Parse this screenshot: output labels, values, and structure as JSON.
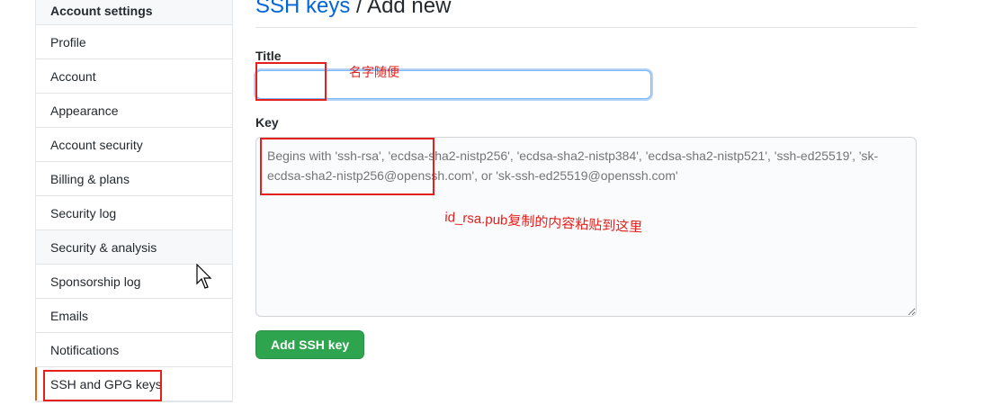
{
  "sidebar": {
    "header": "Account settings",
    "items": [
      {
        "label": "Profile"
      },
      {
        "label": "Account"
      },
      {
        "label": "Appearance"
      },
      {
        "label": "Account security"
      },
      {
        "label": "Billing & plans"
      },
      {
        "label": "Security log"
      },
      {
        "label": "Security & analysis"
      },
      {
        "label": "Sponsorship log"
      },
      {
        "label": "Emails"
      },
      {
        "label": "Notifications"
      },
      {
        "label": "SSH and GPG keys"
      }
    ]
  },
  "main": {
    "breadcrumb_link": "SSH keys",
    "breadcrumb_rest": " / Add new",
    "title_label": "Title",
    "title_value": "",
    "key_label": "Key",
    "key_placeholder": "Begins with 'ssh-rsa', 'ecdsa-sha2-nistp256', 'ecdsa-sha2-nistp384', 'ecdsa-sha2-nistp521', 'ssh-ed25519', 'sk-ecdsa-sha2-nistp256@openssh.com', or 'sk-ssh-ed25519@openssh.com'",
    "submit_label": "Add SSH key"
  },
  "annotations": {
    "title_note": "名字随便",
    "key_note": "id_rsa.pub复制的内容粘贴到这里",
    "color": "#e5201b"
  },
  "colors": {
    "link": "#0366d6",
    "primary_button": "#2ea44f",
    "focus_ring": "#79b8ff"
  }
}
